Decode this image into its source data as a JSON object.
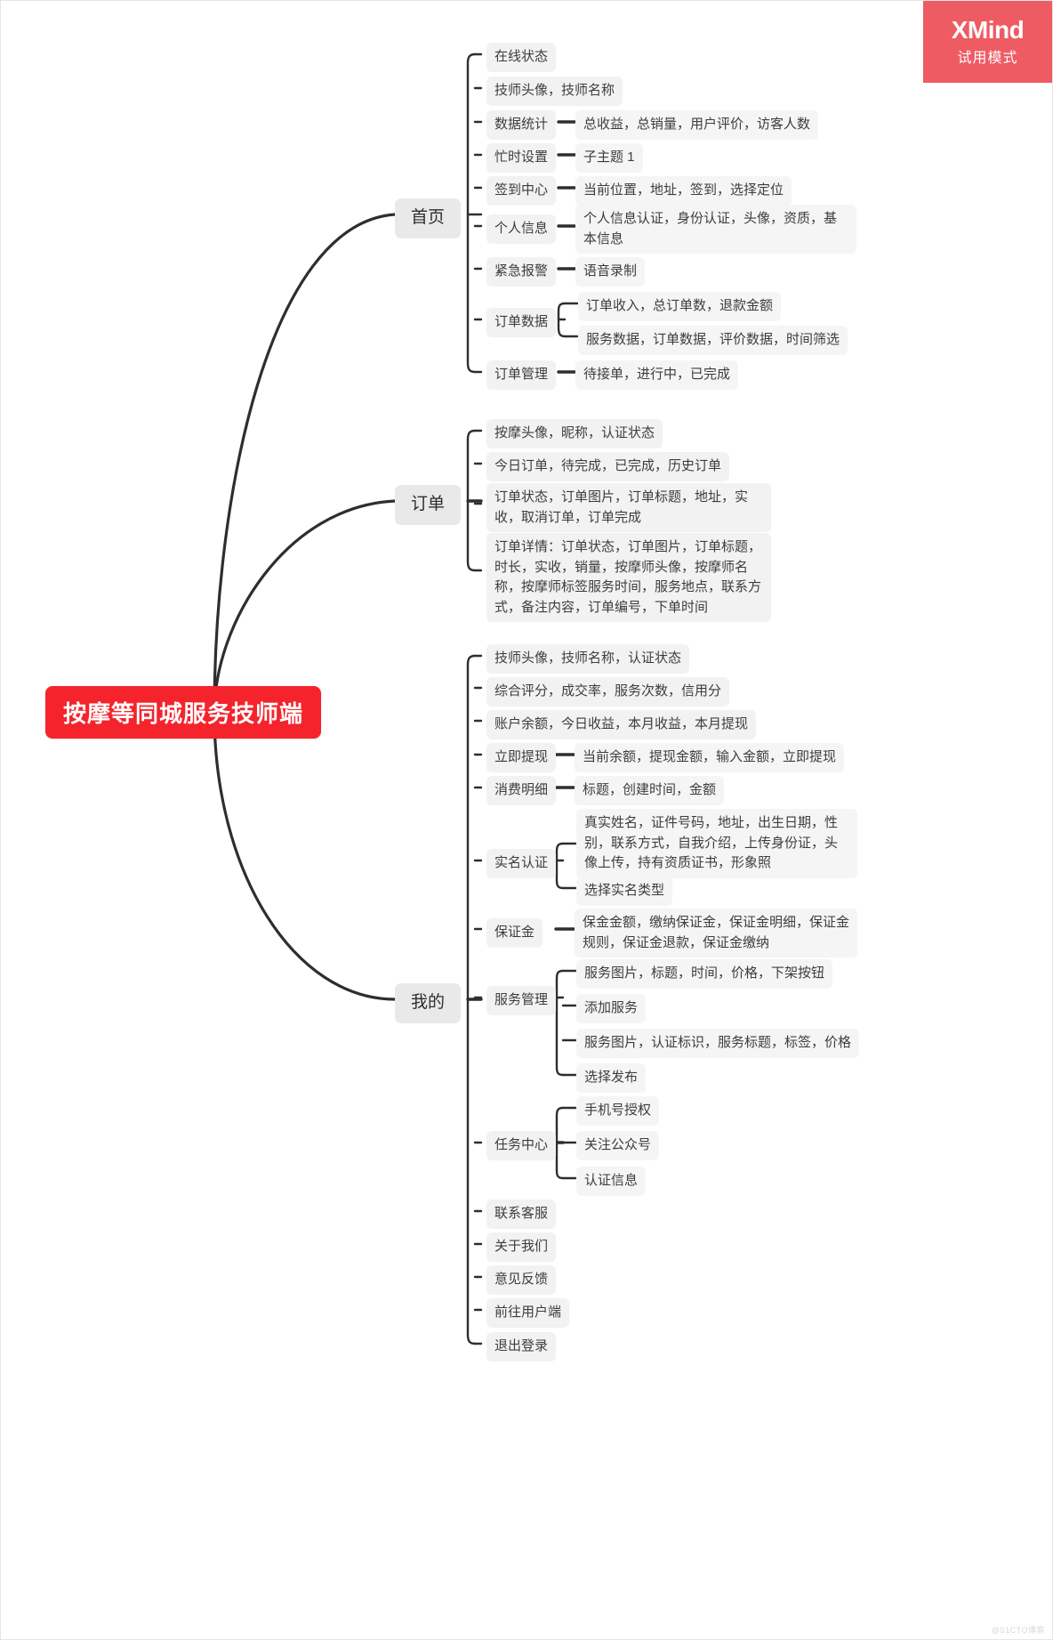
{
  "app": {
    "brand": "XMind",
    "trial_label": "试用模式",
    "watermark": "@51CTO博客"
  },
  "root": {
    "label": "按摩等同城服务技师端"
  },
  "branches": [
    {
      "label": "首页",
      "children": [
        {
          "label": "在线状态",
          "children": []
        },
        {
          "label": "技师头像，技师名称",
          "children": []
        },
        {
          "label": "数据统计",
          "children": [
            {
              "label": "总收益，总销量，用户评价，访客人数"
            }
          ]
        },
        {
          "label": "忙时设置",
          "children": [
            {
              "label": "子主题 1"
            }
          ]
        },
        {
          "label": "签到中心",
          "children": [
            {
              "label": "当前位置，地址，签到，选择定位"
            }
          ]
        },
        {
          "label": "个人信息",
          "children": [
            {
              "label": "个人信息认证，身份认证，头像，资质，基本信息"
            }
          ]
        },
        {
          "label": "紧急报警",
          "children": [
            {
              "label": "语音录制"
            }
          ]
        },
        {
          "label": "订单数据",
          "children": [
            {
              "label": "订单收入，总订单数，退款金额"
            },
            {
              "label": "服务数据，订单数据，评价数据，时间筛选"
            }
          ]
        },
        {
          "label": "订单管理",
          "children": [
            {
              "label": "待接单，进行中，已完成"
            }
          ]
        }
      ]
    },
    {
      "label": "订单",
      "children": [
        {
          "label": "按摩头像，昵称，认证状态",
          "children": []
        },
        {
          "label": "今日订单，待完成，已完成，历史订单",
          "children": []
        },
        {
          "label": "订单状态，订单图片，订单标题，地址，实收，取消订单，订单完成",
          "children": []
        },
        {
          "label": "订单详情：订单状态，订单图片，订单标题，时长，实收，销量，按摩师头像，按摩师名称，按摩师标签服务时间，服务地点，联系方式，备注内容，订单编号，下单时间",
          "children": []
        }
      ]
    },
    {
      "label": "我的",
      "children": [
        {
          "label": "技师头像，技师名称，认证状态",
          "children": []
        },
        {
          "label": "综合评分，成交率，服务次数，信用分",
          "children": []
        },
        {
          "label": "账户余额，今日收益，本月收益，本月提现",
          "children": []
        },
        {
          "label": "立即提现",
          "children": [
            {
              "label": "当前余额，提现金额，输入金额，立即提现"
            }
          ]
        },
        {
          "label": "消费明细",
          "children": [
            {
              "label": "标题，创建时间，金额"
            }
          ]
        },
        {
          "label": "实名认证",
          "children": [
            {
              "label": "真实姓名，证件号码，地址，出生日期，性别，联系方式，自我介绍，上传身份证，头像上传，持有资质证书，形象照"
            },
            {
              "label": "选择实名类型"
            }
          ]
        },
        {
          "label": "保证金",
          "children": [
            {
              "label": "保金金额，缴纳保证金，保证金明细，保证金规则，保证金退款，保证金缴纳"
            }
          ]
        },
        {
          "label": "服务管理",
          "children": [
            {
              "label": "服务图片，标题，时间，价格，下架按钮"
            },
            {
              "label": "添加服务"
            },
            {
              "label": "服务图片，认证标识，服务标题，标签，价格"
            },
            {
              "label": "选择发布"
            }
          ]
        },
        {
          "label": "任务中心",
          "children": [
            {
              "label": "手机号授权"
            },
            {
              "label": "关注公众号"
            },
            {
              "label": "认证信息"
            }
          ]
        },
        {
          "label": "联系客服",
          "children": []
        },
        {
          "label": "关于我们",
          "children": []
        },
        {
          "label": "意见反馈",
          "children": []
        },
        {
          "label": "前往用户端",
          "children": []
        },
        {
          "label": "退出登录",
          "children": []
        }
      ]
    }
  ]
}
